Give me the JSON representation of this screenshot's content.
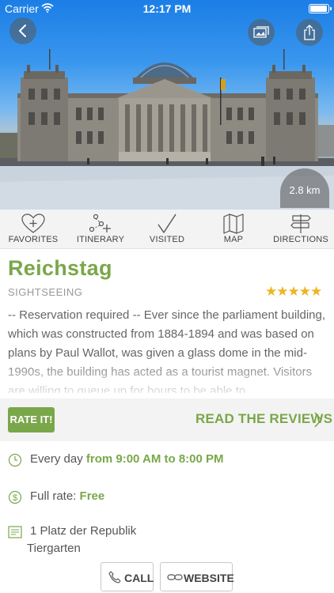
{
  "status_bar": {
    "carrier": "Carrier",
    "time": "12:17 PM"
  },
  "hero": {
    "distance": "2.8 km"
  },
  "icons": {
    "back": "chevron-left-icon",
    "gallery": "photo-gallery-icon",
    "share": "share-icon"
  },
  "actions": [
    {
      "label": "FAVORITES",
      "icon": "heart-plus-icon"
    },
    {
      "label": "ITINERARY",
      "icon": "route-plus-icon"
    },
    {
      "label": "VISITED",
      "icon": "checkmark-icon"
    },
    {
      "label": "MAP",
      "icon": "map-icon"
    },
    {
      "label": "DIRECTIONS",
      "icon": "signpost-icon"
    }
  ],
  "place": {
    "name": "Reichstag",
    "category": "SIGHTSEEING",
    "rating": 4.5,
    "rating_stars": "★★★★★",
    "description": "-- Reservation required -- Ever since the parliament building, which was constructed from 1884-1894 and was based on plans by Paul Wallot, was given a glass dome in the mid-1990s, the building has acted as a tourist magnet. Visitors are willing to queue up for hours to be able to"
  },
  "rating_bar": {
    "rate_label": "RATE IT!",
    "reviews_label": "READ THE REVIEWS"
  },
  "hours": {
    "prefix": "Every day",
    "range": "from 9:00 AM to 8:00 PM"
  },
  "rate": {
    "label": "Full rate:",
    "value": "Free"
  },
  "address": {
    "line1": "1 Platz der Republik",
    "line2": "Tiergarten"
  },
  "buttons": {
    "call": "CALL",
    "website": "WEBSITE"
  },
  "colors": {
    "accent": "#7aa74a",
    "stars": "#f0b322"
  }
}
